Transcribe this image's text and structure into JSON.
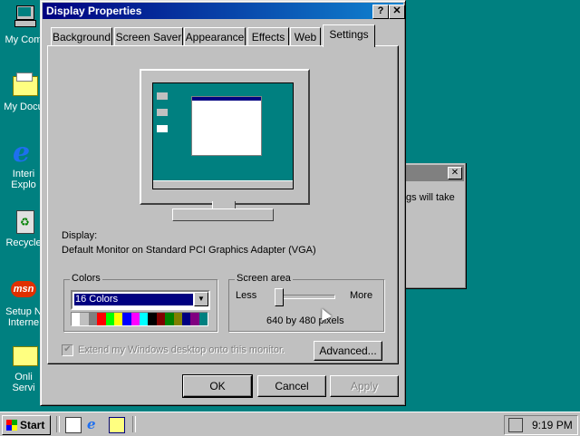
{
  "desktop": {
    "icons": [
      {
        "name": "my-computer",
        "label": "My Com"
      },
      {
        "name": "my-documents",
        "label": "My Docu"
      },
      {
        "name": "internet-explorer",
        "label1": "Interi",
        "label2": "Explo"
      },
      {
        "name": "recycle-bin",
        "label": "Recycle"
      },
      {
        "name": "setup-msn",
        "label1": "Setup N",
        "label2": "Interne"
      },
      {
        "name": "online-services",
        "label1": "Onli",
        "label2": "Servi"
      }
    ]
  },
  "background_dialog": {
    "text": "gs will take"
  },
  "window": {
    "title": "Display Properties",
    "help_label": "?",
    "close_label": "✕",
    "tabs": [
      "Background",
      "Screen Saver",
      "Appearance",
      "Effects",
      "Web",
      "Settings"
    ],
    "active_tab": "Settings",
    "display_label": "Display:",
    "display_value": "Default Monitor on Standard PCI Graphics Adapter (VGA)",
    "colors": {
      "group_label": "Colors",
      "selected": "16 Colors",
      "palette": [
        "#ffffff",
        "#c0c0c0",
        "#808080",
        "#ff0000",
        "#00ff00",
        "#ffff00",
        "#0000ff",
        "#ff00ff",
        "#00ffff",
        "#000000",
        "#800000",
        "#008000",
        "#808000",
        "#000080",
        "#800080",
        "#008080"
      ]
    },
    "screen_area": {
      "group_label": "Screen area",
      "less_label": "Less",
      "more_label": "More",
      "value_text": "640 by 480 pixels",
      "slider_level": 0
    },
    "extend_checkbox_label": "Extend my Windows desktop onto this monitor.",
    "extend_checked": true,
    "advanced_label": "Advanced...",
    "ok_label": "OK",
    "cancel_label": "Cancel",
    "apply_label": "Apply"
  },
  "taskbar": {
    "start_label": "Start",
    "clock": "9:19 PM"
  }
}
